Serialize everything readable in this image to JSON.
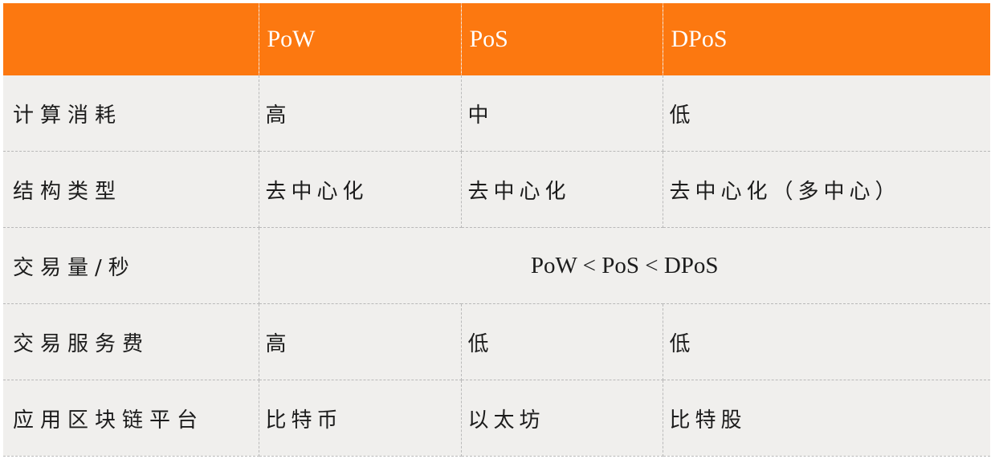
{
  "table": {
    "headers": [
      "",
      "PoW",
      "PoS",
      "DPoS"
    ],
    "rows": [
      {
        "label": "计算消耗",
        "pow": "高",
        "pos": "中",
        "dpos": "低"
      },
      {
        "label": "结构类型",
        "pow": "去中心化",
        "pos": "去中心化",
        "dpos": "去中心化（多中心）"
      },
      {
        "label": "交易量/秒",
        "merged": "PoW < PoS < DPoS"
      },
      {
        "label": "交易服务费",
        "pow": "高",
        "pos": "低",
        "dpos": "低"
      },
      {
        "label": "应用区块链平台",
        "pow": "比特币",
        "pos": "以太坊",
        "dpos": "比特股"
      }
    ]
  },
  "colors": {
    "header_bg": "#fc7810",
    "header_text": "#ffffff",
    "body_bg": "#f0efed",
    "grid_line": "#b9b9b9"
  }
}
